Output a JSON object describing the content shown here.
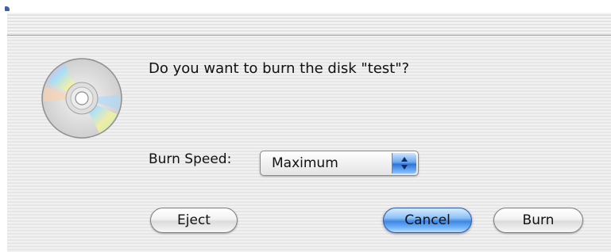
{
  "dialog": {
    "message": "Do you want to burn the disk \"test\"?",
    "icon": "cd-disc-icon"
  },
  "burn_speed": {
    "label": "Burn Speed:",
    "selected": "Maximum"
  },
  "buttons": {
    "eject": "Eject",
    "cancel": "Cancel",
    "burn": "Burn"
  },
  "colors": {
    "default_button": "#3f86e4",
    "background_stripe_light": "#f1f1f1",
    "background_stripe_dark": "#e6e6e6"
  }
}
